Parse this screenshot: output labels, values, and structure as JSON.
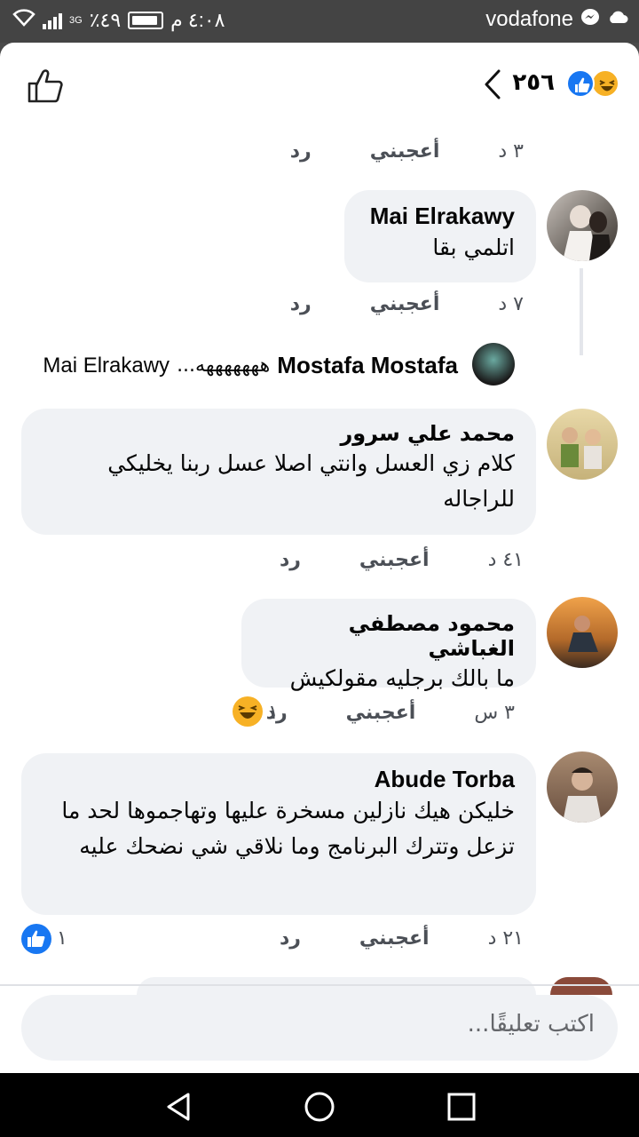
{
  "statusbar": {
    "time": "٤:٠٨ م",
    "battery": "٤٩٪",
    "network": "3G",
    "carrier": "vodafone",
    "icons": [
      "battery-icon",
      "signal-icon",
      "wifi-icon",
      "cloud-icon",
      "messenger-icon"
    ]
  },
  "header": {
    "reaction_count": "٢٥٦",
    "reaction_icons": [
      "like-icon",
      "haha-icon"
    ]
  },
  "comments": {
    "c0": {
      "time": "٣ د",
      "like": "أعجبني",
      "reply": "رد"
    },
    "c1": {
      "name": "Mai Elrakawy",
      "text": "اتلمي بقا",
      "time": "٧ د",
      "like": "أعجبني",
      "reply": "رد"
    },
    "reply_preview": {
      "name": "Mostafa Mostafa",
      "text": "هههههههه...",
      "to": "Mai Elrakawy"
    },
    "c2": {
      "name": "محمد علي سرور",
      "text": "كلام زي العسل وانتي اصلا عسل ربنا يخليكي للراجاله",
      "time": "٤١ د",
      "like": "أعجبني",
      "reply": "رد"
    },
    "c3": {
      "name": "محمود مصطفي الغباشي",
      "text": "ما بالك برجليه مقولكيش",
      "time": "٣ س",
      "like": "أعجبني",
      "reply": "رد",
      "reactions": "١"
    },
    "c4": {
      "name": "Abude Torba",
      "text": "خليكن هيك نازلين مسخرة عليها وتهاجموها لحد ما تزعل وتترك البرنامج وما نلاقي شي نضحك عليه",
      "time": "٢١ د",
      "like": "أعجبني",
      "reply": "رد",
      "reactions": "١"
    }
  },
  "composer": {
    "placeholder": "اكتب تعليقًا..."
  },
  "colors": {
    "like_blue": "#1877f2",
    "haha_yellow": "#f7b125",
    "bubble_bg": "#f0f2f5"
  }
}
